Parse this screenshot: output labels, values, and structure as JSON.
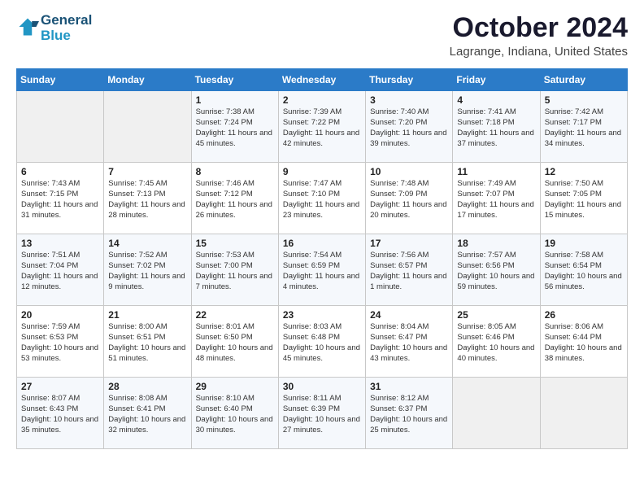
{
  "header": {
    "logo_line1": "General",
    "logo_line2": "Blue",
    "month": "October 2024",
    "location": "Lagrange, Indiana, United States"
  },
  "days_of_week": [
    "Sunday",
    "Monday",
    "Tuesday",
    "Wednesday",
    "Thursday",
    "Friday",
    "Saturday"
  ],
  "weeks": [
    [
      {
        "day": "",
        "info": ""
      },
      {
        "day": "",
        "info": ""
      },
      {
        "day": "1",
        "info": "Sunrise: 7:38 AM\nSunset: 7:24 PM\nDaylight: 11 hours and 45 minutes."
      },
      {
        "day": "2",
        "info": "Sunrise: 7:39 AM\nSunset: 7:22 PM\nDaylight: 11 hours and 42 minutes."
      },
      {
        "day": "3",
        "info": "Sunrise: 7:40 AM\nSunset: 7:20 PM\nDaylight: 11 hours and 39 minutes."
      },
      {
        "day": "4",
        "info": "Sunrise: 7:41 AM\nSunset: 7:18 PM\nDaylight: 11 hours and 37 minutes."
      },
      {
        "day": "5",
        "info": "Sunrise: 7:42 AM\nSunset: 7:17 PM\nDaylight: 11 hours and 34 minutes."
      }
    ],
    [
      {
        "day": "6",
        "info": "Sunrise: 7:43 AM\nSunset: 7:15 PM\nDaylight: 11 hours and 31 minutes."
      },
      {
        "day": "7",
        "info": "Sunrise: 7:45 AM\nSunset: 7:13 PM\nDaylight: 11 hours and 28 minutes."
      },
      {
        "day": "8",
        "info": "Sunrise: 7:46 AM\nSunset: 7:12 PM\nDaylight: 11 hours and 26 minutes."
      },
      {
        "day": "9",
        "info": "Sunrise: 7:47 AM\nSunset: 7:10 PM\nDaylight: 11 hours and 23 minutes."
      },
      {
        "day": "10",
        "info": "Sunrise: 7:48 AM\nSunset: 7:09 PM\nDaylight: 11 hours and 20 minutes."
      },
      {
        "day": "11",
        "info": "Sunrise: 7:49 AM\nSunset: 7:07 PM\nDaylight: 11 hours and 17 minutes."
      },
      {
        "day": "12",
        "info": "Sunrise: 7:50 AM\nSunset: 7:05 PM\nDaylight: 11 hours and 15 minutes."
      }
    ],
    [
      {
        "day": "13",
        "info": "Sunrise: 7:51 AM\nSunset: 7:04 PM\nDaylight: 11 hours and 12 minutes."
      },
      {
        "day": "14",
        "info": "Sunrise: 7:52 AM\nSunset: 7:02 PM\nDaylight: 11 hours and 9 minutes."
      },
      {
        "day": "15",
        "info": "Sunrise: 7:53 AM\nSunset: 7:00 PM\nDaylight: 11 hours and 7 minutes."
      },
      {
        "day": "16",
        "info": "Sunrise: 7:54 AM\nSunset: 6:59 PM\nDaylight: 11 hours and 4 minutes."
      },
      {
        "day": "17",
        "info": "Sunrise: 7:56 AM\nSunset: 6:57 PM\nDaylight: 11 hours and 1 minute."
      },
      {
        "day": "18",
        "info": "Sunrise: 7:57 AM\nSunset: 6:56 PM\nDaylight: 10 hours and 59 minutes."
      },
      {
        "day": "19",
        "info": "Sunrise: 7:58 AM\nSunset: 6:54 PM\nDaylight: 10 hours and 56 minutes."
      }
    ],
    [
      {
        "day": "20",
        "info": "Sunrise: 7:59 AM\nSunset: 6:53 PM\nDaylight: 10 hours and 53 minutes."
      },
      {
        "day": "21",
        "info": "Sunrise: 8:00 AM\nSunset: 6:51 PM\nDaylight: 10 hours and 51 minutes."
      },
      {
        "day": "22",
        "info": "Sunrise: 8:01 AM\nSunset: 6:50 PM\nDaylight: 10 hours and 48 minutes."
      },
      {
        "day": "23",
        "info": "Sunrise: 8:03 AM\nSunset: 6:48 PM\nDaylight: 10 hours and 45 minutes."
      },
      {
        "day": "24",
        "info": "Sunrise: 8:04 AM\nSunset: 6:47 PM\nDaylight: 10 hours and 43 minutes."
      },
      {
        "day": "25",
        "info": "Sunrise: 8:05 AM\nSunset: 6:46 PM\nDaylight: 10 hours and 40 minutes."
      },
      {
        "day": "26",
        "info": "Sunrise: 8:06 AM\nSunset: 6:44 PM\nDaylight: 10 hours and 38 minutes."
      }
    ],
    [
      {
        "day": "27",
        "info": "Sunrise: 8:07 AM\nSunset: 6:43 PM\nDaylight: 10 hours and 35 minutes."
      },
      {
        "day": "28",
        "info": "Sunrise: 8:08 AM\nSunset: 6:41 PM\nDaylight: 10 hours and 32 minutes."
      },
      {
        "day": "29",
        "info": "Sunrise: 8:10 AM\nSunset: 6:40 PM\nDaylight: 10 hours and 30 minutes."
      },
      {
        "day": "30",
        "info": "Sunrise: 8:11 AM\nSunset: 6:39 PM\nDaylight: 10 hours and 27 minutes."
      },
      {
        "day": "31",
        "info": "Sunrise: 8:12 AM\nSunset: 6:37 PM\nDaylight: 10 hours and 25 minutes."
      },
      {
        "day": "",
        "info": ""
      },
      {
        "day": "",
        "info": ""
      }
    ]
  ]
}
